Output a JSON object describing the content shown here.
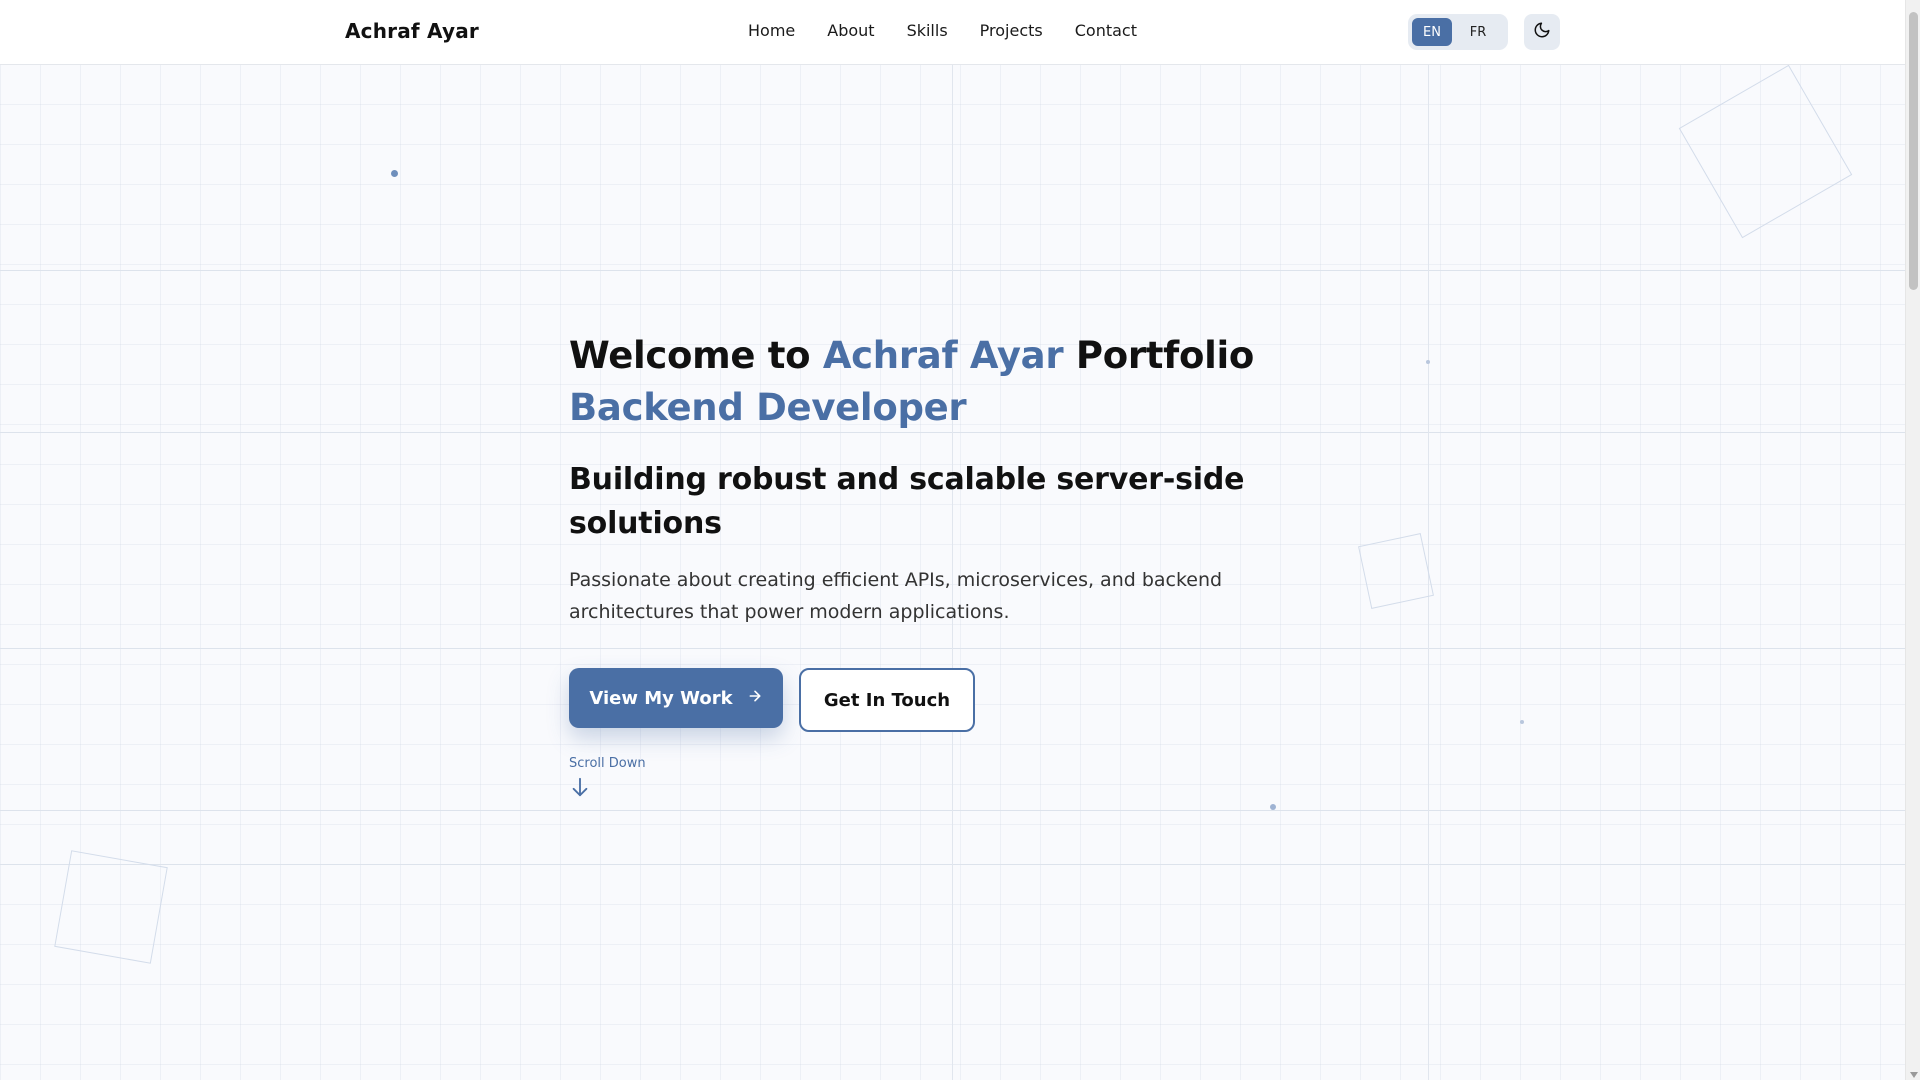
{
  "header": {
    "brand": "Achraf Ayar",
    "nav": [
      "Home",
      "About",
      "Skills",
      "Projects",
      "Contact"
    ],
    "languages": [
      {
        "label": "EN",
        "active": true
      },
      {
        "label": "FR",
        "active": false
      }
    ],
    "theme_icon": "moon-icon"
  },
  "hero": {
    "title_prefix": "Welcome to ",
    "title_name": "Achraf Ayar",
    "title_suffix": " Portfolio",
    "role": "Backend Developer",
    "subtitle": "Building robust and scalable server-side solutions",
    "description": "Passionate about creating efficient APIs, microservices, and backend architectures that power modern applications.",
    "primary_button": "View My Work",
    "secondary_button": "Get In Touch",
    "scroll_label": "Scroll Down"
  },
  "colors": {
    "accent": "#4a6fa5",
    "background": "#f9fafd",
    "text": "#111111"
  }
}
